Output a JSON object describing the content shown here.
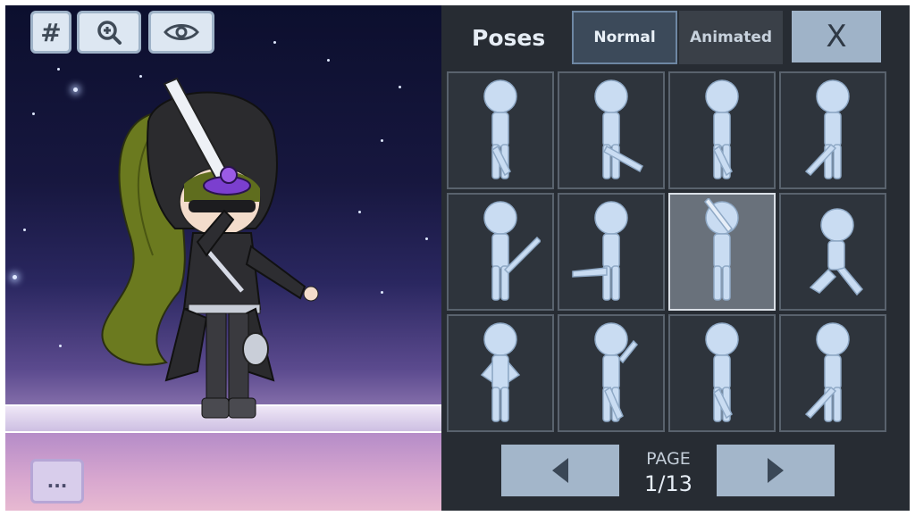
{
  "toolbar": {
    "grid_label": "#",
    "zoom_icon": "zoom-in-icon",
    "visibility_icon": "eye-icon",
    "more_label": "..."
  },
  "panel": {
    "title": "Poses",
    "tabs": [
      {
        "label": "Normal",
        "selected": true
      },
      {
        "label": "Animated",
        "selected": false
      }
    ],
    "close_label": "X",
    "poses": [
      {
        "id": 1,
        "selected": false,
        "prop": "sword"
      },
      {
        "id": 2,
        "selected": false,
        "prop": "sword"
      },
      {
        "id": 3,
        "selected": false,
        "prop": "sword"
      },
      {
        "id": 4,
        "selected": false,
        "prop": "sword"
      },
      {
        "id": 5,
        "selected": false,
        "prop": "sword"
      },
      {
        "id": 6,
        "selected": false,
        "prop": "sword"
      },
      {
        "id": 7,
        "selected": true,
        "prop": "sword"
      },
      {
        "id": 8,
        "selected": false,
        "prop": "none"
      },
      {
        "id": 9,
        "selected": false,
        "prop": "none"
      },
      {
        "id": 10,
        "selected": false,
        "prop": "sword"
      },
      {
        "id": 11,
        "selected": false,
        "prop": "sword"
      },
      {
        "id": 12,
        "selected": false,
        "prop": "sword"
      }
    ]
  },
  "pagination": {
    "label": "PAGE",
    "page": "1/13"
  },
  "colors": {
    "panel_bg": "#272c33",
    "button_accent": "#9fb3c8",
    "silhouette": "#c9dcf2"
  }
}
